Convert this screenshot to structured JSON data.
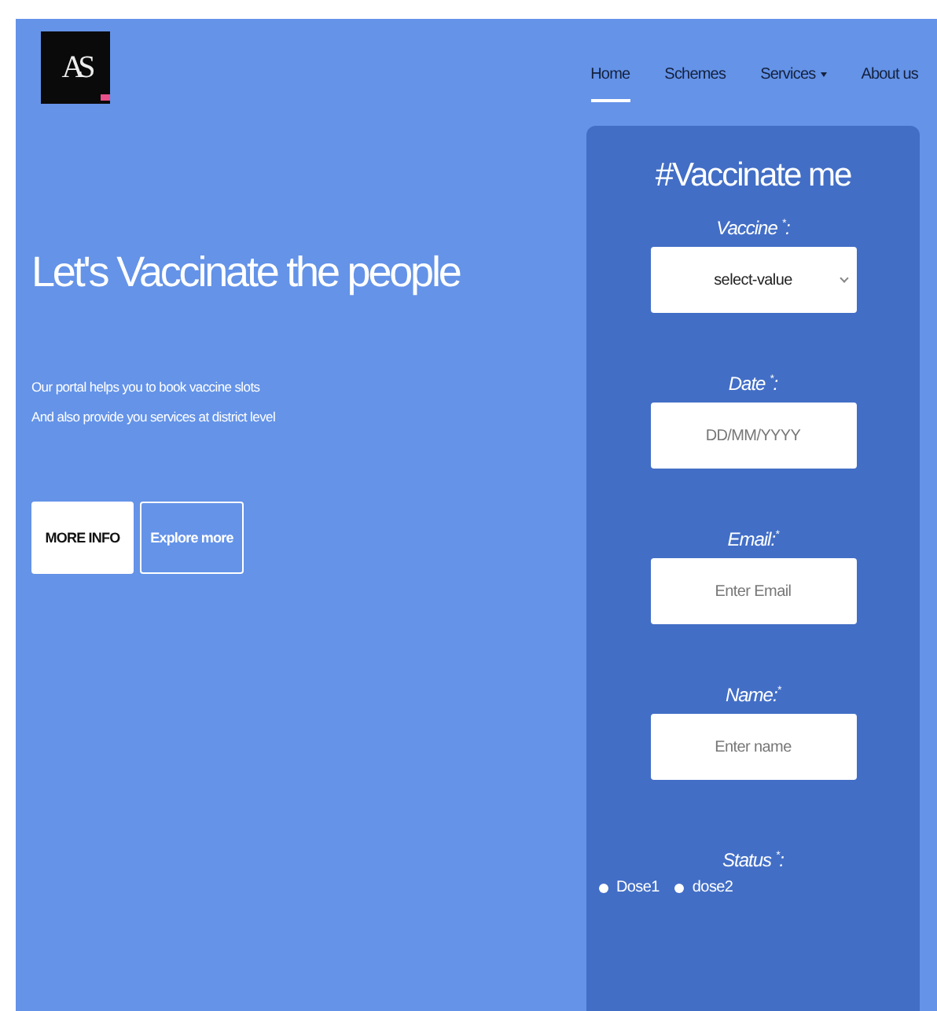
{
  "logo": {
    "text": "AS"
  },
  "nav": [
    {
      "label": "Home",
      "selected": true,
      "dropdown": false
    },
    {
      "label": "Schemes",
      "selected": false,
      "dropdown": false
    },
    {
      "label": "Services",
      "selected": false,
      "dropdown": true
    },
    {
      "label": "About us",
      "selected": false,
      "dropdown": false
    }
  ],
  "hero": {
    "title": "Let's Vaccinate the people",
    "lines": [
      "Our portal helps you to book vaccine slots",
      "And also provide you services at district level"
    ],
    "buttons": [
      {
        "label": "MORE INFO",
        "kind": "solid"
      },
      {
        "label": "Explore more",
        "kind": "outline"
      }
    ]
  },
  "form": {
    "title": "#Vaccinate me",
    "fields": [
      {
        "label": "Vaccine $^{*}$:",
        "kind": "select",
        "value": "select-value"
      },
      {
        "label": "Date $^{*}$:",
        "kind": "input",
        "placeholder": "DD/MM/YYYY"
      },
      {
        "label": "Email:$^{*}$",
        "kind": "input",
        "placeholder": "Enter Email"
      },
      {
        "label": "Name:$^{*}$",
        "kind": "input",
        "placeholder": "Enter name"
      }
    ],
    "status": {
      "label": "Status $^{*}$:",
      "options": [
        {
          "label": "Dose1",
          "selected": false
        },
        {
          "label": "dose2",
          "selected": false
        }
      ]
    }
  }
}
